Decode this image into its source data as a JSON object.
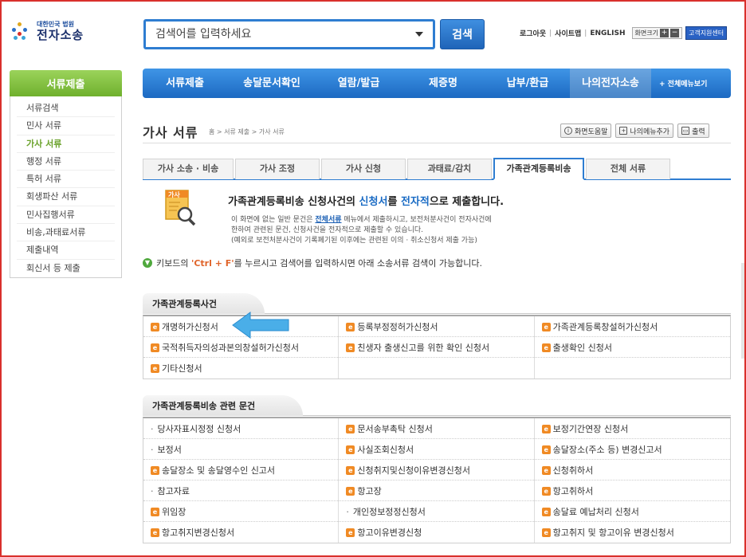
{
  "header": {
    "logo_small": "대한민국 법원",
    "logo_big": "전자소송",
    "search_placeholder": "검색어를 입력하세요",
    "search_button": "검색",
    "util_links": [
      "로그아웃",
      "사이트맵",
      "ENGLISH"
    ],
    "font_size_label": "화면크기",
    "font_plus": "+",
    "font_minus": "−",
    "help_center": "고객지원센터"
  },
  "sidebar": {
    "title": "서류제출",
    "items": [
      {
        "label": "서류검색"
      },
      {
        "label": "민사 서류"
      },
      {
        "label": "가사 서류",
        "active": true
      },
      {
        "label": "행정 서류"
      },
      {
        "label": "특허 서류"
      },
      {
        "label": "회생파산 서류"
      },
      {
        "label": "민사집행서류"
      },
      {
        "label": "비송,과태료서류"
      },
      {
        "label": "제출내역"
      },
      {
        "label": "회신서 등 제출"
      }
    ]
  },
  "nav": {
    "items": [
      "서류제출",
      "송달문서확인",
      "열람/발급",
      "제증명",
      "납부/환급",
      "나의전자소송"
    ],
    "all_menu": "+ 전체메뉴보기"
  },
  "page": {
    "title": "가사 서류",
    "breadcrumb": "홈 > 서류 제출 > 가사 서류",
    "tools": [
      "화면도움말",
      "나의메뉴추가",
      "출력"
    ]
  },
  "tabs": [
    "가사 소송 · 비송",
    "가사 조정",
    "가사 신청",
    "과태료/감치",
    "가족관계등록비송",
    "전체 서류"
  ],
  "info": {
    "icon_label": "가사",
    "title_pre": "가족관계등록비송 신청사건의 ",
    "title_hl1": "신청서",
    "title_mid": "를 ",
    "title_hl2": "전자적",
    "title_post": "으로 제출합니다.",
    "line1_pre": "이 화면에 없는 일반 문건은 ",
    "line1_link": "전체서류",
    "line1_post": " 메뉴에서 제출하시고, 보전처분사건이 전자사건에",
    "line2": "한하여 관련된 문건, 신청사건을 전자적으로 제출할 수 있습니다.",
    "line3": "(예외로 보전처분사건이 기록폐기된 이후에는 관련된 이의 · 취소신청서 제출 가능)"
  },
  "tip": {
    "pre": "키보드의 ",
    "key": "'Ctrl + F'",
    "post": "를 누르시고 검색어를 입력하시면 아래 소송서류 검색이 가능합니다."
  },
  "section1": {
    "title": "가족관계등록사건",
    "rows": [
      [
        {
          "t": "개명허가신청서",
          "e": true
        },
        {
          "t": "등록부정정허가신청서",
          "e": true
        },
        {
          "t": "가족관계등록창설허가신청서",
          "e": true
        }
      ],
      [
        {
          "t": "국적취득자의성과본의창설허가신청서",
          "e": true
        },
        {
          "t": "친생자 출생신고를 위한 확인 신청서",
          "e": true
        },
        {
          "t": "출생확인 신청서",
          "e": true
        }
      ],
      [
        {
          "t": "기타신청서",
          "e": true
        },
        {
          "t": "",
          "e": false
        },
        {
          "t": "",
          "e": false
        }
      ]
    ]
  },
  "section2": {
    "title": "가족관계등록비송 관련 문건",
    "rows": [
      [
        {
          "t": "당사자표시정정 신청서",
          "e": false
        },
        {
          "t": "문서송부촉탁 신청서",
          "e": true
        },
        {
          "t": "보정기간연장 신청서",
          "e": true
        }
      ],
      [
        {
          "t": "보정서",
          "e": false
        },
        {
          "t": "사실조회신청서",
          "e": true
        },
        {
          "t": "송달장소(주소 등) 변경신고서",
          "e": true
        }
      ],
      [
        {
          "t": "송달장소 및 송달영수인 신고서",
          "e": true
        },
        {
          "t": "신청취지및신청이유변경신청서",
          "e": true
        },
        {
          "t": "신청취하서",
          "e": true
        }
      ],
      [
        {
          "t": "참고자료",
          "e": false
        },
        {
          "t": "항고장",
          "e": true
        },
        {
          "t": "항고취하서",
          "e": true
        }
      ],
      [
        {
          "t": "위임장",
          "e": true
        },
        {
          "t": "개인정보정정신청서",
          "e": false
        },
        {
          "t": "송달료 예납처리 신청서",
          "e": true
        }
      ],
      [
        {
          "t": "항고취지변경신청서",
          "e": true
        },
        {
          "t": "항고이유변경신청",
          "e": true
        },
        {
          "t": "항고취지 및 항고이유 변경신청서",
          "e": true
        }
      ]
    ]
  },
  "colors": {
    "accent": "#2e7dd1",
    "side": "#6fb02d",
    "doc_icon": "#f08a24",
    "arrow": "#4aaee8"
  }
}
